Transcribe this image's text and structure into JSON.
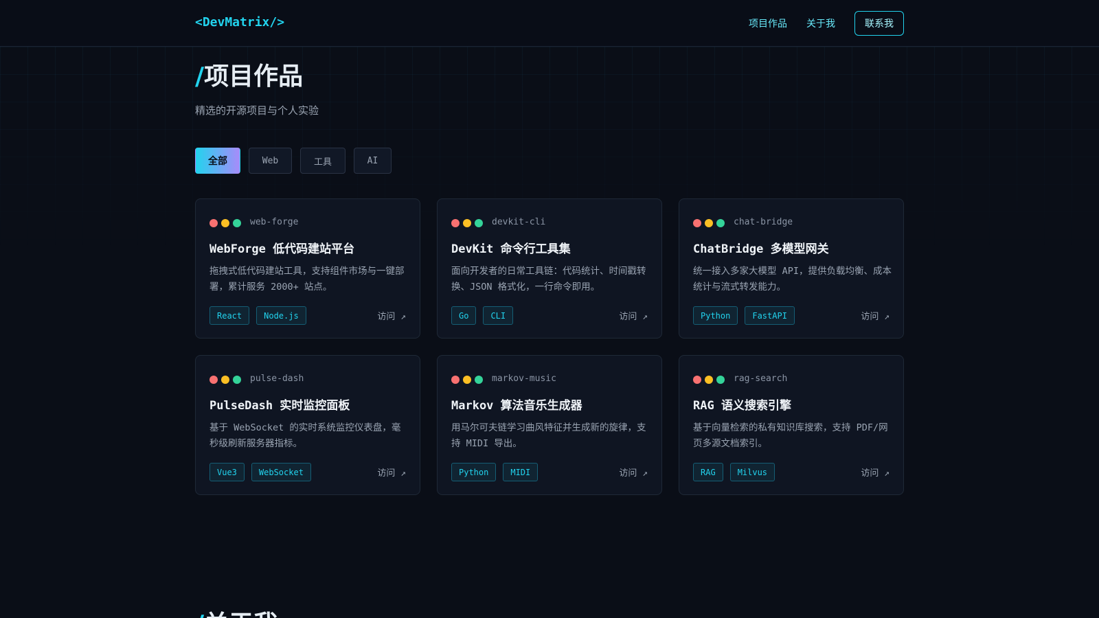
{
  "header": {
    "logo": "<DevMatrix/>",
    "nav": {
      "projects": "项目作品",
      "about": "关于我"
    },
    "contact": "联系我"
  },
  "section": {
    "slash": "/",
    "title": "项目作品",
    "subtitle": "精选的开源项目与个人实验"
  },
  "filters": [
    {
      "label": "全部",
      "active": true
    },
    {
      "label": "Web",
      "active": false
    },
    {
      "label": "工具",
      "active": false
    },
    {
      "label": "AI",
      "active": false
    }
  ],
  "cards": [
    {
      "slug": "web-forge",
      "title": "WebForge 低代码建站平台",
      "desc": "拖拽式低代码建站工具，支持组件市场与一键部署，累计服务 2000+ 站点。",
      "tags": [
        "React",
        "Node.js"
      ],
      "visit": "访问 ↗"
    },
    {
      "slug": "devkit-cli",
      "title": "DevKit 命令行工具集",
      "desc": "面向开发者的日常工具链：代码统计、时间戳转换、JSON 格式化，一行命令即用。",
      "tags": [
        "Go",
        "CLI"
      ],
      "visit": "访问 ↗"
    },
    {
      "slug": "chat-bridge",
      "title": "ChatBridge 多模型网关",
      "desc": "统一接入多家大模型 API，提供负载均衡、成本统计与流式转发能力。",
      "tags": [
        "Python",
        "FastAPI"
      ],
      "visit": "访问 ↗"
    },
    {
      "slug": "pulse-dash",
      "title": "PulseDash 实时监控面板",
      "desc": "基于 WebSocket 的实时系统监控仪表盘，毫秒级刷新服务器指标。",
      "tags": [
        "Vue3",
        "WebSocket"
      ],
      "visit": "访问 ↗"
    },
    {
      "slug": "markov-music",
      "title": "Markov 算法音乐生成器",
      "desc": "用马尔可夫链学习曲风特征并生成新的旋律，支持 MIDI 导出。",
      "tags": [
        "Python",
        "MIDI"
      ],
      "visit": "访问 ↗"
    },
    {
      "slug": "rag-search",
      "title": "RAG 语义搜索引擎",
      "desc": "基于向量检索的私有知识库搜索，支持 PDF/网页多源文档索引。",
      "tags": [
        "RAG",
        "Milvus"
      ],
      "visit": "访问 ↗"
    }
  ],
  "about": {
    "slash": "/",
    "title": "关于我"
  },
  "colors": {
    "accent": "#22d3ee",
    "accent2": "#a78bfa",
    "bg": "#0a0e17"
  }
}
